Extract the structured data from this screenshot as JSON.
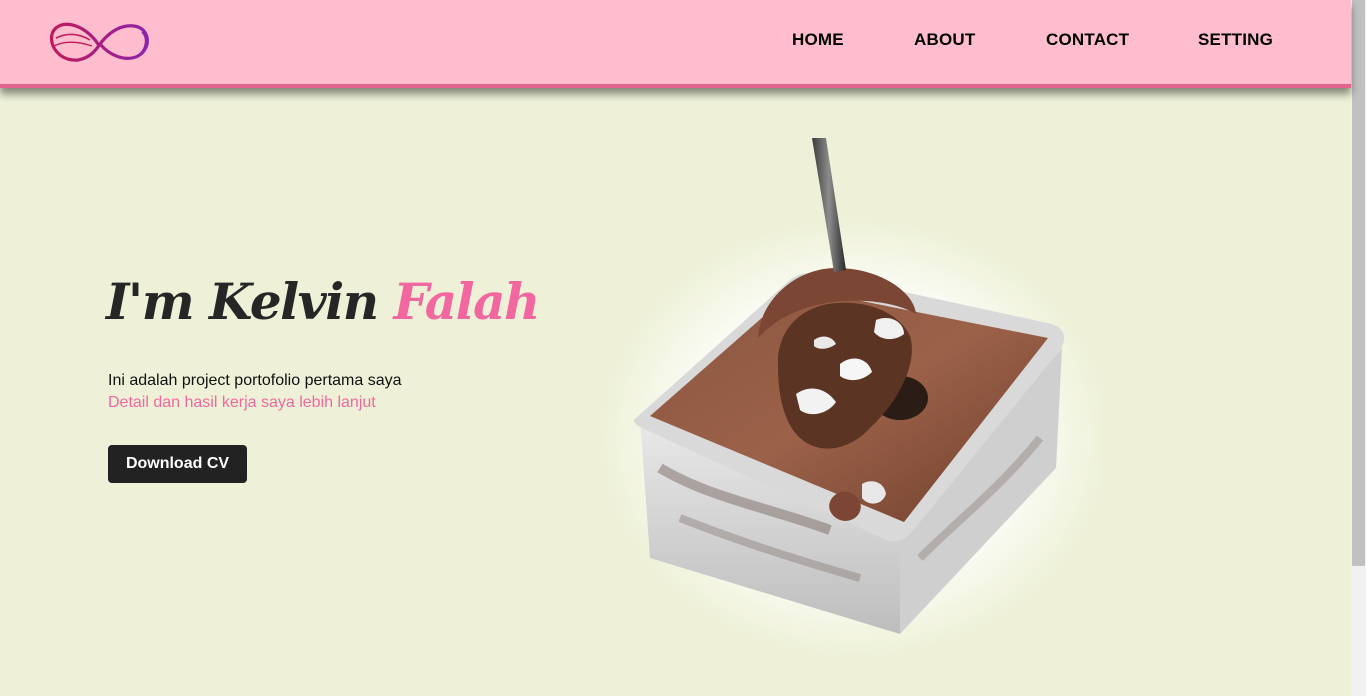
{
  "brand": {
    "logo": "infinity-logo",
    "logo_colors": [
      "#c2185b",
      "#8e24aa"
    ]
  },
  "nav": {
    "items": [
      {
        "label": "HOME"
      },
      {
        "label": "ABOUT"
      },
      {
        "label": "CONTACT"
      },
      {
        "label": "SETTING"
      }
    ]
  },
  "hero": {
    "name_prefix": "I'm Kelvin",
    "name_accent": "Falah",
    "intro": "Ini adalah project portofolio pertama saya",
    "detail": "Detail dan hasil kerja saya lebih lanjut",
    "button_label": "Download CV",
    "image": "chocolate-dessert-box-with-spoon"
  },
  "colors": {
    "header_bg": "#ffbdcd",
    "header_border": "#e4638f",
    "page_bg": "#eef1d7",
    "accent": "#f2679f",
    "button_bg": "#222222"
  }
}
